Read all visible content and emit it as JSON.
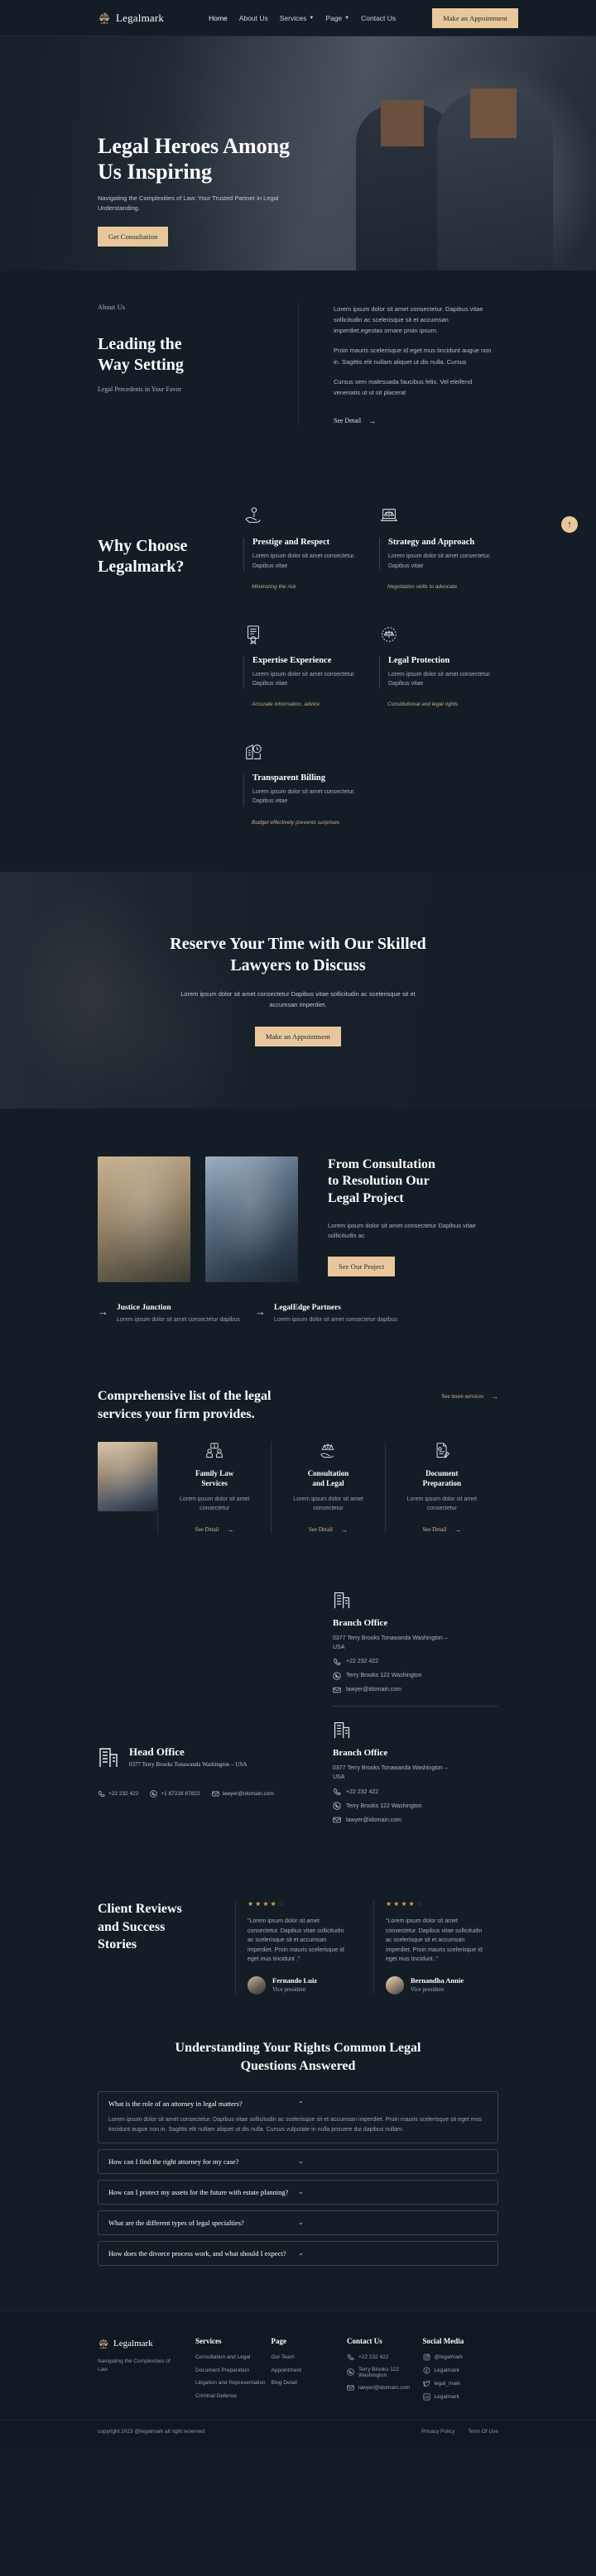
{
  "brand": {
    "name": "Legalmark",
    "icon": "scales-icon"
  },
  "nav": {
    "items": [
      {
        "label": "Home",
        "caret": false
      },
      {
        "label": "About Us",
        "caret": false
      },
      {
        "label": "Services",
        "caret": true
      },
      {
        "label": "Page",
        "caret": true
      },
      {
        "label": "Contact Us",
        "caret": false
      }
    ],
    "cta": "Make an Appointment"
  },
  "hero": {
    "title_line1": "Legal Heroes Among",
    "title_line2": "Us Inspiring",
    "subtitle": "Navigating the Complexities of Law: Your Trusted Partner in Legal Understanding.",
    "button": "Get Consultation"
  },
  "about": {
    "eyebrow": "About Us",
    "title_line1": "Leading the",
    "title_line2": "Way Setting",
    "subtitle": "Legal Precedents in Your Favor",
    "paragraphs": [
      "Lorem ipsum dolor sit amet consectetur. Dapibus vitae sollicitudin ac scelerisque sit et accumsan imperdiet.egestas ornare proin ipsum.",
      "Proin mauris scelerisque id eget mus tincidunt augue non in. Sagittis elit nullam aliquet ut dis nulla. Cursus",
      "Cursus sem malesuada faucibus felis. Vel eleifend venenatis ut ut sit placerat"
    ],
    "link": "See Detail"
  },
  "why": {
    "title_line1": "Why Choose",
    "title_line2": "Legalmark?",
    "scroll_top_icon": "arrow-up-icon",
    "features": [
      {
        "icon": "hand-person-icon",
        "title": "Prestige and Respect",
        "desc": "Lorem ipsum dolor sit amet consectetur. Dapibus vitae",
        "note": "Minimizing the risk"
      },
      {
        "icon": "scales-laptop-icon",
        "title": "Strategy and Approach",
        "desc": "Lorem ipsum dolor sit amet consectetur. Dapibus vitae",
        "note": "Negotiation skills to advocate"
      },
      {
        "icon": "certificate-icon",
        "title": "Expertise Experience",
        "desc": "Lorem ipsum dolor sit amet consectetur. Dapibus vitae",
        "note": "Accurate information, advice"
      },
      {
        "icon": "scales-shield-icon",
        "title": "Legal Protection",
        "desc": "Lorem ipsum dolor sit amet consectetur. Dapibus vitae",
        "note": "Constitutional and legal rights"
      },
      {
        "icon": "building-clock-icon",
        "title": "Transparent Billing",
        "desc": "Lorem ipsum dolor sit amet consectetur. Dapibus vitae",
        "note": "Budget effectively prevents surprises"
      }
    ]
  },
  "cta": {
    "title_line1": "Reserve Your Time with Our Skilled",
    "title_line2": "Lawyers to Discuss",
    "desc": "Lorem ipsum dolor sit amet consectetur Dapibus vitae sollicitudin ac scelerisque sit et accumsan imperdiet.",
    "button": "Make an Appointment"
  },
  "project": {
    "title_line1": "From Consultation",
    "title_line2": "to Resolution Our",
    "title_line3": "Legal Project",
    "desc": "Lorem ipsum dolor sit amet consectetur Dapibus vitae sollicitudin ac",
    "button": "See Our Project",
    "cards": [
      {
        "title": "Justice Junction",
        "desc": "Lorem ipsum dolor sit amet consectetur dapibus"
      },
      {
        "title": "LegalEdge Partners",
        "desc": "Lorem ipsum dolor sit amet consectetur dapibus"
      }
    ]
  },
  "services": {
    "title_line1": "Comprehensive list of the legal",
    "title_line2": "services your firm provides.",
    "more_link": "See more services",
    "items": [
      {
        "icon": "meeting-icon",
        "title_line1": "Family Law",
        "title_line2": "Services",
        "desc": "Lorem ipsum dolor sit amet consectetur",
        "link": "See Detail"
      },
      {
        "icon": "scales-hand-icon",
        "title_line1": "Consultation",
        "title_line2": "and Legal",
        "desc": "Lorem ipsum dolor sit amet consectetur",
        "link": "See Detail"
      },
      {
        "icon": "document-pen-icon",
        "title_line1": "Document",
        "title_line2": "Preparation",
        "desc": "Lorem ipsum dolor sit amet consectetur",
        "link": "See Detail"
      }
    ]
  },
  "offices": {
    "head": {
      "icon": "building-icon",
      "title": "Head Office",
      "address": "0377 Terry Brooks Tonawanda Washington – USA",
      "contacts": [
        {
          "icon": "phone-icon",
          "value": "+22 232 422"
        },
        {
          "icon": "whatsapp-icon",
          "value": "+1 87228 87822"
        },
        {
          "icon": "mail-icon",
          "value": "lawyer@idomain.com"
        }
      ]
    },
    "branches": [
      {
        "icon": "building-icon",
        "title": "Branch Office",
        "address": "0377 Terry Brooks Tonawanda Washington – USA",
        "contacts": [
          {
            "icon": "phone-icon",
            "value": "+22 232 422"
          },
          {
            "icon": "whatsapp-icon",
            "value": "Terry Brooks 122 Washington"
          },
          {
            "icon": "mail-icon",
            "value": "lawyer@idomain.com"
          }
        ]
      },
      {
        "icon": "building-icon",
        "title": "Branch Office",
        "address": "0377 Terry Brooks Tonawanda Washington – USA",
        "contacts": [
          {
            "icon": "phone-icon",
            "value": "+22 232 422"
          },
          {
            "icon": "whatsapp-icon",
            "value": "Terry Brooks 122 Washington"
          },
          {
            "icon": "mail-icon",
            "value": "lawyer@idomain.com"
          }
        ]
      }
    ]
  },
  "reviews": {
    "title_line1": "Client Reviews",
    "title_line2": "and Success",
    "title_line3": "Stories",
    "items": [
      {
        "rating": 4,
        "max_rating": 5,
        "quote": "\"Lorem ipsum dolor sit amet consectetur. Dapibus vitae sollicitudin ac scelerisque sit et accumsan imperdiet. Proin mauris scelerisque id eget mus tincidunt .\"",
        "name": "Fernando Luiz",
        "role": "Vice president"
      },
      {
        "rating": 4,
        "max_rating": 5,
        "quote": "\"Lorem ipsum dolor sit amet consectetur. Dapibus vitae sollicitudin ac scelerisque sit et accumsan imperdiet. Proin mauris scelerisque id eget mus tincidunt .\"",
        "name": "Bernandha Annie",
        "role": "Vice president"
      }
    ]
  },
  "faq": {
    "title_line1": "Understanding Your Rights Common Legal",
    "title_line2": "Questions Answered",
    "items": [
      {
        "question": "What is the role of an attorney in legal matters?",
        "answer": "Lorem ipsum dolor sit amet consectetur. Dapibus vitae sollicitudin ac scelerisque sit et accumsan imperdiet. Proin mauris scelerisque sit eget mus tincidunt augue non in. Sagittis elit nullam aliquet ut dis nulla. Cursus vulputate in nulla posuere dui dapibus nullam.",
        "expanded": true,
        "chevron": "chevron-up-icon"
      },
      {
        "question": "How can I find the right attorney for my case?",
        "answer": "",
        "expanded": false,
        "chevron": "chevron-down-icon"
      },
      {
        "question": "How can I protect my assets for the future with estate planning?",
        "answer": "",
        "expanded": false,
        "chevron": "chevron-down-icon"
      },
      {
        "question": "What are the different types of legal specialties?",
        "answer": "",
        "expanded": false,
        "chevron": "chevron-down-icon"
      },
      {
        "question": "How does the divorce process work, and what should I expect?",
        "answer": "",
        "expanded": false,
        "chevron": "chevron-down-icon"
      }
    ]
  },
  "footer": {
    "brand": {
      "name": "Legalmark",
      "tagline": "Navigating the Complexities of Law"
    },
    "columns": [
      {
        "heading": "Services",
        "links": [
          "Consultation and Legal",
          "Document Preparation",
          "Litigation and Representation",
          "Criminal Defense"
        ]
      },
      {
        "heading": "Page",
        "links": [
          "Our Team",
          "Appointment",
          "Blog Detail"
        ]
      }
    ],
    "contact": {
      "heading": "Contact Us",
      "items": [
        {
          "icon": "phone-icon",
          "value": "+22 232 422"
        },
        {
          "icon": "whatsapp-icon",
          "value": "Terry Brooks 122 Washington"
        },
        {
          "icon": "mail-icon",
          "value": "lawyer@idomain.com"
        }
      ]
    },
    "social": {
      "heading": "Social Media",
      "items": [
        {
          "icon": "instagram-icon",
          "value": "@legalmark"
        },
        {
          "icon": "facebook-icon",
          "value": "Legalmark"
        },
        {
          "icon": "twitter-icon",
          "value": "legal_mark"
        },
        {
          "icon": "linkedin-icon",
          "value": "Legalmark"
        }
      ]
    },
    "copyright": "copyright 2023 @legalmark all right reserved",
    "legal_links": [
      "Privacy Policy",
      "Term Of Use"
    ]
  }
}
